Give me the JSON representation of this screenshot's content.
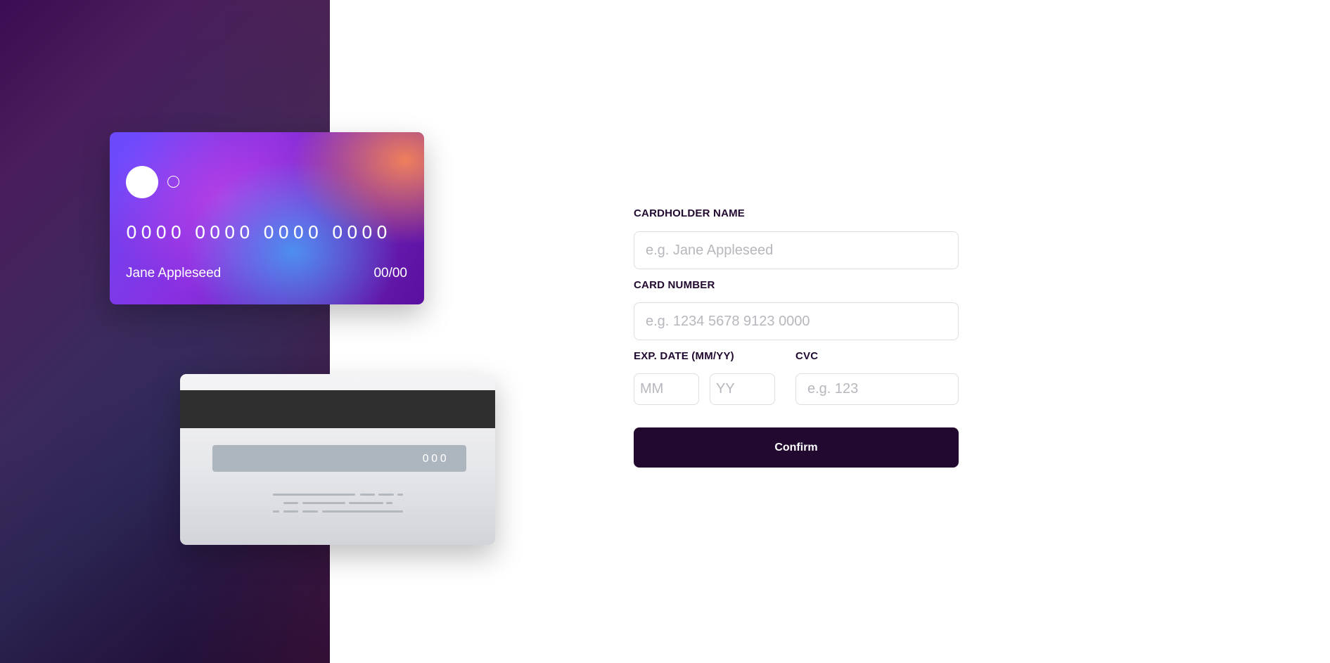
{
  "card_front": {
    "number": "0000 0000 0000 0000",
    "name": "Jane Appleseed",
    "expiry": "00/00"
  },
  "card_back": {
    "cvc": "000"
  },
  "form": {
    "name_label": "CARDHOLDER NAME",
    "name_placeholder": "e.g. Jane Appleseed",
    "number_label": "CARD NUMBER",
    "number_placeholder": "e.g. 1234 5678 9123 0000",
    "exp_label": "EXP. DATE (MM/YY)",
    "mm_placeholder": "MM",
    "yy_placeholder": "YY",
    "cvc_label": "CVC",
    "cvc_placeholder": "e.g. 123",
    "confirm_label": "Confirm"
  },
  "colors": {
    "dark_violet": "#21092f",
    "input_border": "#dedddf",
    "placeholder": "#b9b6bd"
  }
}
